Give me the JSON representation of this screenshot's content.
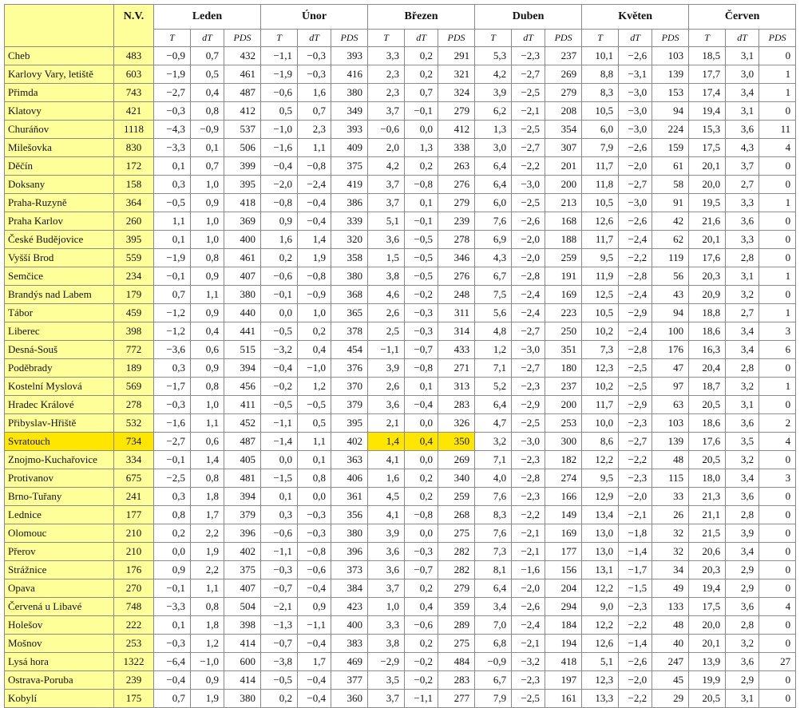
{
  "header": {
    "nv": "N.V.",
    "months": [
      "Leden",
      "Únor",
      "Březen",
      "Duben",
      "Květen",
      "Červen"
    ],
    "sub": [
      "T",
      "dT",
      "PDS"
    ]
  },
  "highlight": {
    "row": 21,
    "cols": [
      0,
      1,
      8,
      9,
      10
    ]
  },
  "rows": [
    {
      "name": "Cheb",
      "nv": "483",
      "v": [
        "−0,9",
        "0,7",
        "432",
        "−1,1",
        "−0,3",
        "393",
        "3,3",
        "0,2",
        "291",
        "5,3",
        "−2,3",
        "237",
        "10,1",
        "−2,6",
        "103",
        "18,5",
        "3,1",
        "0"
      ]
    },
    {
      "name": "Karlovy Vary, letiště",
      "nv": "603",
      "v": [
        "−1,9",
        "0,5",
        "461",
        "−1,9",
        "−0,3",
        "416",
        "2,3",
        "0,2",
        "321",
        "4,2",
        "−2,7",
        "269",
        "8,8",
        "−3,1",
        "139",
        "17,7",
        "3,0",
        "1"
      ]
    },
    {
      "name": "Přimda",
      "nv": "743",
      "v": [
        "−2,7",
        "0,4",
        "487",
        "−0,6",
        "1,6",
        "380",
        "2,3",
        "0,7",
        "324",
        "3,9",
        "−2,5",
        "279",
        "8,3",
        "−3,0",
        "153",
        "17,4",
        "3,4",
        "1"
      ]
    },
    {
      "name": "Klatovy",
      "nv": "421",
      "v": [
        "−0,3",
        "0,8",
        "412",
        "0,5",
        "0,7",
        "349",
        "3,7",
        "−0,1",
        "279",
        "6,2",
        "−2,1",
        "208",
        "10,5",
        "−3,0",
        "94",
        "19,4",
        "3,1",
        "0"
      ]
    },
    {
      "name": "Churáňov",
      "nv": "1118",
      "v": [
        "−4,3",
        "−0,9",
        "537",
        "−1,0",
        "2,3",
        "393",
        "−0,6",
        "0,0",
        "412",
        "1,3",
        "−2,5",
        "354",
        "6,0",
        "−3,0",
        "224",
        "15,3",
        "3,6",
        "11"
      ]
    },
    {
      "name": "Milešovka",
      "nv": "830",
      "v": [
        "−3,3",
        "0,1",
        "506",
        "−1,6",
        "1,1",
        "409",
        "2,0",
        "1,3",
        "338",
        "3,0",
        "−2,7",
        "307",
        "7,9",
        "−2,6",
        "159",
        "17,5",
        "4,3",
        "4"
      ]
    },
    {
      "name": "Děčín",
      "nv": "172",
      "v": [
        "0,1",
        "0,7",
        "399",
        "−0,4",
        "−0,8",
        "375",
        "4,2",
        "0,2",
        "263",
        "6,4",
        "−2,2",
        "201",
        "11,7",
        "−2,0",
        "61",
        "20,1",
        "3,7",
        "0"
      ]
    },
    {
      "name": "Doksany",
      "nv": "158",
      "v": [
        "0,3",
        "1,0",
        "395",
        "−2,0",
        "−2,4",
        "419",
        "3,7",
        "−0,8",
        "276",
        "6,4",
        "−3,0",
        "200",
        "11,8",
        "−2,7",
        "58",
        "20,0",
        "2,7",
        "0"
      ]
    },
    {
      "name": "Praha-Ruzyně",
      "nv": "364",
      "v": [
        "−0,5",
        "0,9",
        "418",
        "−0,8",
        "−0,4",
        "386",
        "3,7",
        "0,1",
        "279",
        "6,0",
        "−2,5",
        "213",
        "10,5",
        "−3,0",
        "91",
        "19,5",
        "3,3",
        "1"
      ]
    },
    {
      "name": "Praha Karlov",
      "nv": "260",
      "v": [
        "1,1",
        "1,0",
        "369",
        "0,9",
        "−0,4",
        "339",
        "5,1",
        "−0,1",
        "239",
        "7,6",
        "−2,6",
        "168",
        "12,6",
        "−2,6",
        "42",
        "21,6",
        "3,6",
        "0"
      ]
    },
    {
      "name": "České Budějovice",
      "nv": "395",
      "v": [
        "0,1",
        "1,0",
        "400",
        "1,6",
        "1,4",
        "320",
        "3,6",
        "−0,5",
        "278",
        "6,9",
        "−2,0",
        "188",
        "11,7",
        "−2,4",
        "62",
        "20,1",
        "3,3",
        "0"
      ]
    },
    {
      "name": "Vyšší Brod",
      "nv": "559",
      "v": [
        "−1,9",
        "0,8",
        "461",
        "0,2",
        "1,9",
        "358",
        "1,5",
        "−0,5",
        "346",
        "4,3",
        "−2,0",
        "259",
        "9,5",
        "−2,2",
        "119",
        "17,6",
        "2,8",
        "0"
      ]
    },
    {
      "name": "Semčice",
      "nv": "234",
      "v": [
        "−0,1",
        "0,9",
        "407",
        "−0,6",
        "−0,8",
        "380",
        "3,8",
        "−0,5",
        "276",
        "6,7",
        "−2,8",
        "191",
        "11,9",
        "−2,8",
        "56",
        "20,3",
        "3,1",
        "1"
      ]
    },
    {
      "name": "Brandýs nad Labem",
      "nv": "179",
      "v": [
        "0,7",
        "1,1",
        "380",
        "−0,1",
        "−0,9",
        "368",
        "4,6",
        "−0,2",
        "248",
        "7,5",
        "−2,4",
        "169",
        "12,5",
        "−2,4",
        "43",
        "20,9",
        "3,2",
        "0"
      ]
    },
    {
      "name": "Tábor",
      "nv": "459",
      "v": [
        "−1,2",
        "0,9",
        "440",
        "0,0",
        "1,0",
        "365",
        "2,6",
        "−0,3",
        "311",
        "5,6",
        "−2,4",
        "223",
        "10,5",
        "−2,9",
        "94",
        "18,8",
        "2,7",
        "1"
      ]
    },
    {
      "name": "Liberec",
      "nv": "398",
      "v": [
        "−1,2",
        "0,4",
        "441",
        "−0,5",
        "0,2",
        "378",
        "2,5",
        "−0,3",
        "314",
        "4,8",
        "−2,7",
        "250",
        "10,2",
        "−2,4",
        "100",
        "18,6",
        "3,4",
        "3"
      ]
    },
    {
      "name": "Desná-Souš",
      "nv": "772",
      "v": [
        "−3,6",
        "0,6",
        "515",
        "−3,2",
        "0,4",
        "454",
        "−1,1",
        "−0,7",
        "433",
        "1,2",
        "−3,0",
        "351",
        "7,3",
        "−2,8",
        "176",
        "16,3",
        "3,4",
        "6"
      ]
    },
    {
      "name": "Poděbrady",
      "nv": "189",
      "v": [
        "0,3",
        "0,9",
        "394",
        "−0,4",
        "−1,0",
        "376",
        "3,9",
        "−0,8",
        "271",
        "7,1",
        "−2,7",
        "180",
        "12,3",
        "−2,5",
        "47",
        "20,4",
        "2,8",
        "0"
      ]
    },
    {
      "name": "Kostelní Myslová",
      "nv": "569",
      "v": [
        "−1,7",
        "0,8",
        "456",
        "−0,2",
        "1,2",
        "370",
        "2,6",
        "0,1",
        "313",
        "5,2",
        "−2,3",
        "237",
        "10,2",
        "−2,5",
        "97",
        "18,7",
        "3,2",
        "1"
      ]
    },
    {
      "name": "Hradec Králové",
      "nv": "278",
      "v": [
        "−0,3",
        "1,0",
        "411",
        "−0,5",
        "−0,5",
        "379",
        "3,6",
        "−0,4",
        "283",
        "6,4",
        "−2,9",
        "200",
        "11,7",
        "−2,9",
        "63",
        "20,5",
        "3,1",
        "0"
      ]
    },
    {
      "name": "Přibyslav-Hřiště",
      "nv": "532",
      "v": [
        "−1,6",
        "1,1",
        "452",
        "−1,1",
        "0,5",
        "395",
        "2,1",
        "0,0",
        "326",
        "4,7",
        "−2,5",
        "253",
        "10,0",
        "−2,3",
        "103",
        "18,6",
        "3,6",
        "2"
      ]
    },
    {
      "name": "Svratouch",
      "nv": "734",
      "v": [
        "−2,7",
        "0,6",
        "487",
        "−1,4",
        "1,1",
        "402",
        "1,4",
        "0,4",
        "350",
        "3,2",
        "−3,0",
        "300",
        "8,6",
        "−2,7",
        "139",
        "17,6",
        "3,5",
        "4"
      ]
    },
    {
      "name": "Znojmo-Kuchařovice",
      "nv": "334",
      "v": [
        "−0,1",
        "1,4",
        "405",
        "0,0",
        "0,1",
        "363",
        "4,1",
        "0,0",
        "269",
        "7,1",
        "−2,3",
        "182",
        "12,2",
        "−2,2",
        "48",
        "20,5",
        "3,2",
        "0"
      ]
    },
    {
      "name": "Protivanov",
      "nv": "675",
      "v": [
        "−2,5",
        "0,8",
        "481",
        "−1,5",
        "0,8",
        "406",
        "1,6",
        "0,2",
        "340",
        "4,0",
        "−2,8",
        "274",
        "9,5",
        "−2,3",
        "115",
        "18,0",
        "3,4",
        "3"
      ]
    },
    {
      "name": "Brno-Tuřany",
      "nv": "241",
      "v": [
        "0,3",
        "1,8",
        "394",
        "0,1",
        "0,0",
        "361",
        "4,5",
        "0,2",
        "259",
        "7,6",
        "−2,3",
        "166",
        "12,9",
        "−2,0",
        "33",
        "21,3",
        "3,6",
        "0"
      ]
    },
    {
      "name": "Lednice",
      "nv": "177",
      "v": [
        "0,8",
        "1,7",
        "379",
        "0,3",
        "−0,3",
        "356",
        "4,1",
        "−0,8",
        "268",
        "8,3",
        "−2,2",
        "149",
        "13,4",
        "−2,1",
        "26",
        "21,1",
        "2,8",
        "0"
      ]
    },
    {
      "name": "Olomouc",
      "nv": "210",
      "v": [
        "0,2",
        "2,2",
        "396",
        "−0,6",
        "−0,3",
        "380",
        "3,9",
        "0,0",
        "275",
        "7,6",
        "−2,1",
        "169",
        "13,0",
        "−1,8",
        "32",
        "21,5",
        "3,9",
        "0"
      ]
    },
    {
      "name": "Přerov",
      "nv": "210",
      "v": [
        "0,0",
        "1,9",
        "402",
        "−1,1",
        "−0,8",
        "396",
        "3,6",
        "−0,3",
        "282",
        "7,3",
        "−2,1",
        "177",
        "13,0",
        "−1,4",
        "32",
        "20,6",
        "3,4",
        "0"
      ]
    },
    {
      "name": "Strážnice",
      "nv": "176",
      "v": [
        "0,9",
        "2,2",
        "375",
        "−0,3",
        "−0,6",
        "373",
        "3,6",
        "−0,7",
        "282",
        "8,1",
        "−1,6",
        "156",
        "13,1",
        "−1,7",
        "34",
        "20,3",
        "2,9",
        "0"
      ]
    },
    {
      "name": "Opava",
      "nv": "270",
      "v": [
        "−0,1",
        "1,1",
        "407",
        "−0,7",
        "−0,4",
        "384",
        "3,7",
        "0,2",
        "279",
        "6,4",
        "−2,0",
        "204",
        "12,2",
        "−1,5",
        "49",
        "19,4",
        "2,9",
        "0"
      ]
    },
    {
      "name": "Červená u Libavé",
      "nv": "748",
      "v": [
        "−3,3",
        "0,8",
        "504",
        "−2,1",
        "0,9",
        "423",
        "1,0",
        "0,4",
        "359",
        "3,4",
        "−2,6",
        "294",
        "9,0",
        "−2,3",
        "133",
        "17,5",
        "3,6",
        "4"
      ]
    },
    {
      "name": "Holešov",
      "nv": "222",
      "v": [
        "0,1",
        "1,8",
        "398",
        "−1,3",
        "−1,1",
        "400",
        "3,3",
        "−0,6",
        "289",
        "7,0",
        "−2,4",
        "184",
        "12,2",
        "−2,2",
        "48",
        "20,0",
        "2,8",
        "0"
      ]
    },
    {
      "name": "Mošnov",
      "nv": "253",
      "v": [
        "−0,3",
        "1,2",
        "414",
        "−0,7",
        "−0,4",
        "383",
        "3,8",
        "0,2",
        "275",
        "6,8",
        "−2,1",
        "194",
        "12,6",
        "−1,4",
        "40",
        "20,1",
        "3,2",
        "0"
      ]
    },
    {
      "name": "Lysá hora",
      "nv": "1322",
      "v": [
        "−6,4",
        "−1,0",
        "600",
        "−3,8",
        "1,7",
        "469",
        "−2,9",
        "−0,2",
        "484",
        "−0,9",
        "−3,2",
        "418",
        "5,1",
        "−2,6",
        "247",
        "13,9",
        "3,6",
        "27"
      ]
    },
    {
      "name": "Ostrava-Poruba",
      "nv": "239",
      "v": [
        "−0,4",
        "0,9",
        "414",
        "−0,5",
        "−0,4",
        "377",
        "3,5",
        "−0,2",
        "283",
        "6,7",
        "−2,3",
        "197",
        "12,3",
        "−2,0",
        "45",
        "19,9",
        "2,9",
        "0"
      ]
    },
    {
      "name": "Kobylí",
      "nv": "175",
      "v": [
        "0,7",
        "1,9",
        "380",
        "0,2",
        "−0,4",
        "360",
        "3,7",
        "−1,1",
        "277",
        "7,9",
        "−2,5",
        "161",
        "13,3",
        "−2,2",
        "29",
        "20,5",
        "3,1",
        "0"
      ]
    }
  ]
}
